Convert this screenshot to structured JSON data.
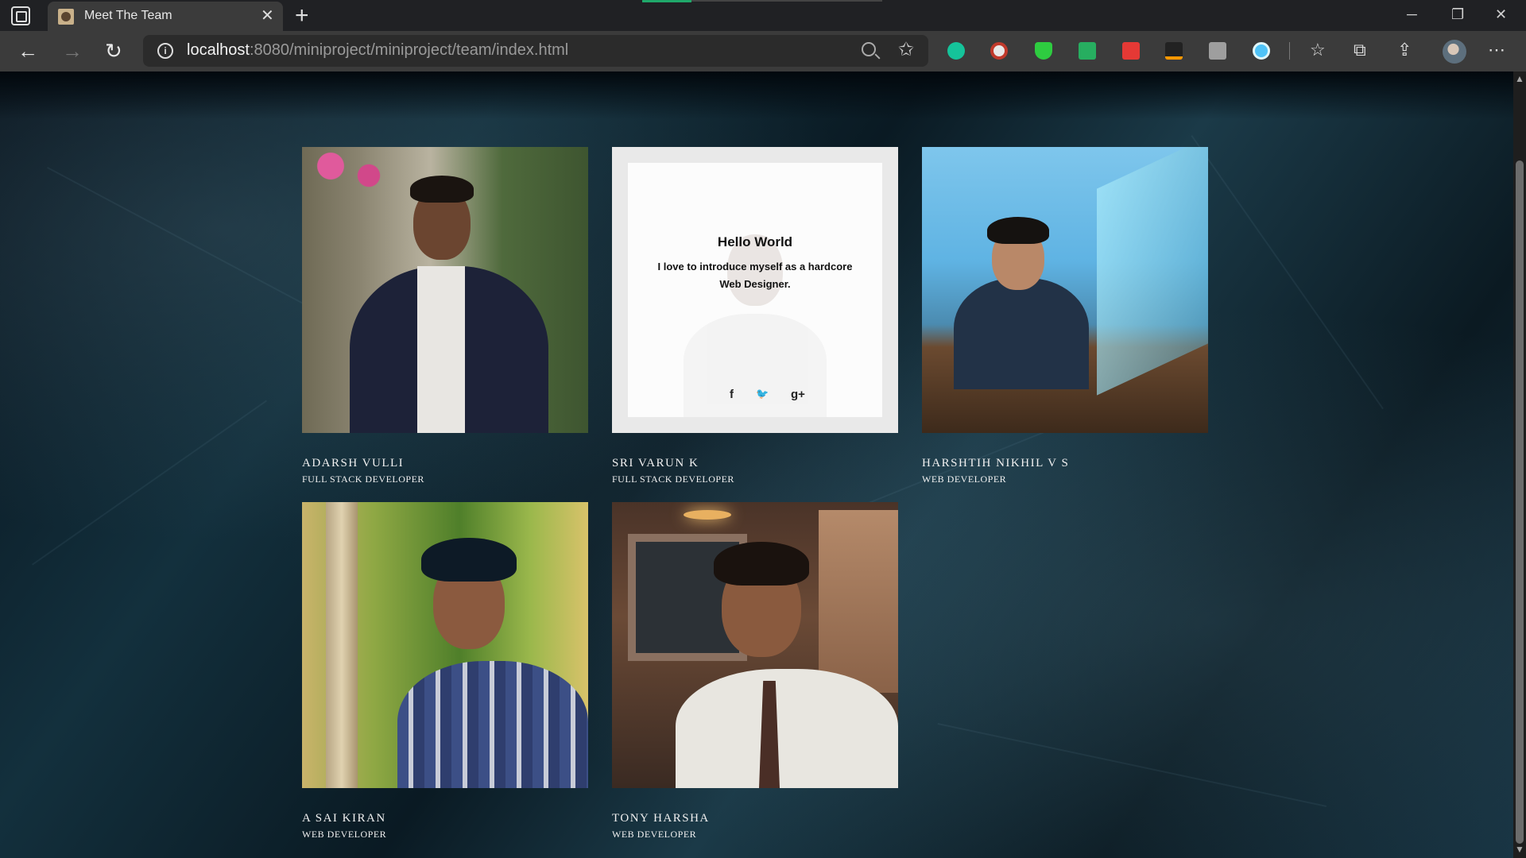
{
  "browser": {
    "tab_title": "Meet The Team",
    "tab_close": "✕",
    "new_tab": "+",
    "url_host": "localhost",
    "url_rest": ":8080/miniproject/miniproject/team/index.html",
    "back": "←",
    "forward": "→",
    "refresh": "↻",
    "minimize": "─",
    "restore": "❐",
    "close": "✕",
    "favorites": "☆",
    "collections": "⧉",
    "share": "⇪",
    "menu": "⋯",
    "fav_add": "✩"
  },
  "hover_card": {
    "title": "Hello World",
    "text": "I love to introduce myself as a hardcore Web Designer.",
    "social": {
      "facebook": "f",
      "twitter": "🐦",
      "google_plus": "g+"
    }
  },
  "team": [
    {
      "name": "ADARSH VULLI",
      "role": "FULL STACK DEVELOPER"
    },
    {
      "name": "SRI VARUN K",
      "role": "FULL STACK DEVELOPER"
    },
    {
      "name": "HARSHTIH NIKHIL V S",
      "role": "WEB DEVELOPER"
    },
    {
      "name": "A SAI KIRAN",
      "role": "WEB DEVELOPER"
    },
    {
      "name": "TONY HARSHA",
      "role": "WEB DEVELOPER"
    }
  ],
  "colors": {
    "accent_load": "#1fa86a",
    "chrome_dark": "#202124",
    "chrome_toolbar": "#3b3b3b",
    "text_light": "#f0f0f0"
  }
}
